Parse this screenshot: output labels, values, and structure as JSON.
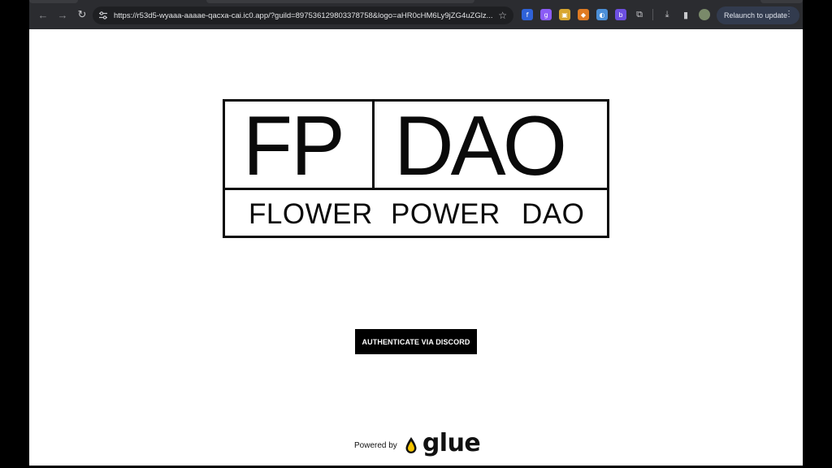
{
  "browser": {
    "url": "https://r53d5-wyaaa-aaaae-qacxa-cai.ic0.app/?guild=897536129803378758&logo=aHR0cHM6Ly9jZG4uZGlz...",
    "relaunch_label": "Relaunch to update",
    "extensions": [
      {
        "icon": "extension-1-icon",
        "color": "#2f62d8",
        "glyph": "f"
      },
      {
        "icon": "extension-2-icon",
        "color": "#8b5cf6",
        "glyph": "g"
      },
      {
        "icon": "extension-3-icon",
        "color": "#d8a62f",
        "glyph": "▣"
      },
      {
        "icon": "extension-4-icon",
        "color": "#e07b22",
        "glyph": "◆"
      },
      {
        "icon": "extension-5-icon",
        "color": "#4b8fd8",
        "glyph": "◐"
      },
      {
        "icon": "extension-6-icon",
        "color": "#6d4fe0",
        "glyph": "b"
      }
    ]
  },
  "logo": {
    "top_left": "FP",
    "top_right": "DAO",
    "words": [
      "FLOWER",
      "POWER",
      "DAO"
    ]
  },
  "auth_button_label": "AUTHENTICATE VIA DISCORD",
  "footer": {
    "powered_by": "Powered by",
    "brand": "glue",
    "brand_accent_color": "#f5c400"
  }
}
